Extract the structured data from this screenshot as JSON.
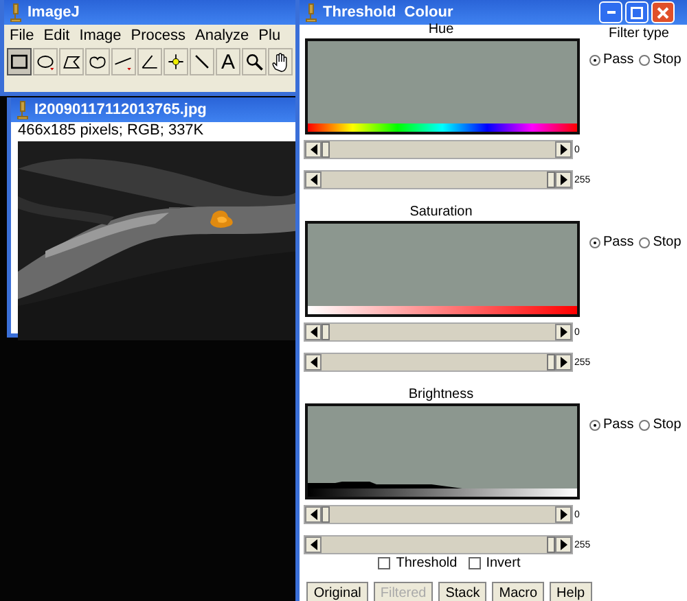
{
  "imagej": {
    "title": "ImageJ",
    "menu": [
      "File",
      "Edit",
      "Image",
      "Process",
      "Analyze",
      "Plu"
    ],
    "tools": [
      {
        "kind": "rect",
        "selected": true
      },
      {
        "kind": "oval",
        "selected": false
      },
      {
        "kind": "polygon",
        "selected": false
      },
      {
        "kind": "freehand",
        "selected": false
      },
      {
        "kind": "line",
        "selected": false
      },
      {
        "kind": "angle",
        "selected": false
      },
      {
        "kind": "point",
        "selected": false
      },
      {
        "kind": "wand",
        "selected": false
      },
      {
        "kind": "text",
        "label": "A",
        "selected": false
      },
      {
        "kind": "magnifier",
        "selected": false
      },
      {
        "kind": "hand",
        "selected": false
      }
    ]
  },
  "image_window": {
    "title": "I20090117112013765.jpg",
    "info": "466x185 pixels; RGB; 337K"
  },
  "threshold": {
    "title": "Threshold  Colour",
    "filter_type_label": "Filter type",
    "channels": [
      {
        "name": "Hue",
        "kind": "hue",
        "filter": [
          {
            "label": "Pass",
            "selected": true
          },
          {
            "label": "Stop",
            "selected": false
          }
        ],
        "sliders": [
          {
            "level": 0,
            "reading": "0"
          },
          {
            "level": 1,
            "reading": "255"
          }
        ]
      },
      {
        "name": "Saturation",
        "kind": "saturation",
        "filter": [
          {
            "label": "Pass",
            "selected": true
          },
          {
            "label": "Stop",
            "selected": false
          }
        ],
        "sliders": [
          {
            "level": 0,
            "reading": "0"
          },
          {
            "level": 1,
            "reading": "255"
          }
        ]
      },
      {
        "name": "Brightness",
        "kind": "brightness",
        "filter": [
          {
            "label": "Pass",
            "selected": true
          },
          {
            "label": "Stop",
            "selected": false
          }
        ],
        "sliders": [
          {
            "level": 0,
            "reading": "0"
          },
          {
            "level": 1,
            "reading": "255"
          }
        ]
      }
    ],
    "options": [
      {
        "label": "Threshold",
        "checked": false
      },
      {
        "label": "Invert",
        "checked": false
      }
    ],
    "buttons": [
      {
        "label": "Original",
        "disabled": false
      },
      {
        "label": "Filtered",
        "disabled": true
      },
      {
        "label": "Stack",
        "disabled": false
      },
      {
        "label": "Macro",
        "disabled": false
      },
      {
        "label": "Help",
        "disabled": false
      }
    ]
  }
}
